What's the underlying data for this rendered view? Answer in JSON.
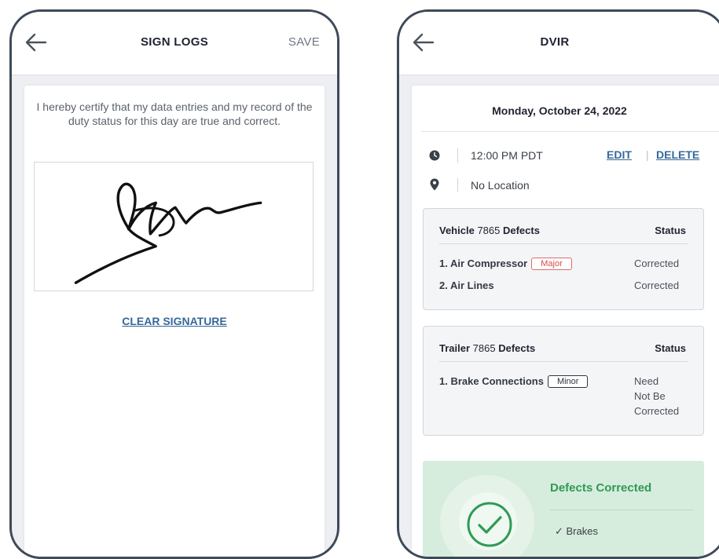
{
  "sign_logs": {
    "title": "SIGN LOGS",
    "save_label": "SAVE",
    "certification_text": "I hereby certify that my data entries and my record of the duty status for this day are true and correct.",
    "clear_signature_label": "CLEAR SIGNATURE"
  },
  "dvir": {
    "title": "DVIR",
    "date": "Monday, October 24, 2022",
    "time": "12:00 PM PDT",
    "location": "No Location",
    "edit_label": "EDIT",
    "action_separator": "|",
    "delete_label": "DELETE",
    "vehicle": {
      "label": "Vehicle",
      "number": "7865",
      "suffix": "Defects",
      "status_header": "Status",
      "items": [
        {
          "name": "1. Air Compressor",
          "badge": "Major",
          "status": "Corrected"
        },
        {
          "name": "2. Air Lines",
          "badge": "",
          "status": "Corrected"
        }
      ]
    },
    "trailer": {
      "label": "Trailer",
      "number": "7865",
      "suffix": "Defects",
      "status_header": "Status",
      "items": [
        {
          "name": "1. Brake Connections",
          "badge": "Minor",
          "status_lines": [
            "Need",
            "Not Be",
            "Corrected"
          ]
        }
      ]
    },
    "defects_corrected": {
      "title": "Defects Corrected",
      "first_item": "✓ Brakes"
    }
  },
  "colors": {
    "accent_link": "#36689a",
    "major_badge": "#d84a4a",
    "success_green": "#2f9a55",
    "success_bg": "#d6ecdd",
    "phone_frame": "#3e4a57"
  },
  "icons": [
    "back-arrow-icon",
    "clock-icon",
    "location-pin-icon",
    "checkmark-circle-icon"
  ]
}
